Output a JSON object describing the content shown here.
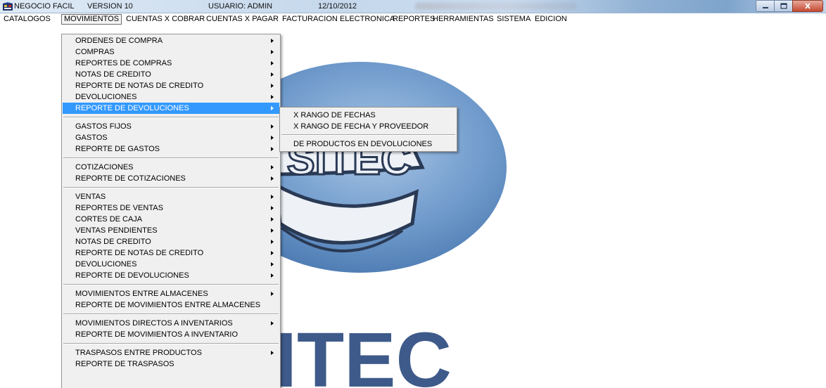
{
  "window": {
    "app_name": "NEGOCIO FACIL",
    "version": "VERSION 10",
    "user": "USUARIO: ADMIN",
    "date": "12/10/2012"
  },
  "icons": [
    "app-icon",
    "minimize-icon",
    "maximize-icon",
    "close-icon",
    "submenu-arrow-icon"
  ],
  "colors": {
    "highlight": "#3399ff",
    "menu_bg": "#f0f0f0",
    "close_button": "#c54a33"
  },
  "menubar": {
    "items": [
      {
        "label": "CATALOGOS"
      },
      {
        "label": "MOVIMIENTOS",
        "active": true
      },
      {
        "label": "CUENTAS X COBRAR"
      },
      {
        "label": "CUENTAS X PAGAR"
      },
      {
        "label": "FACTURACION ELECTRONICA"
      },
      {
        "label": "REPORTES"
      },
      {
        "label": "HERRAMIENTAS"
      },
      {
        "label": "SISTEMA"
      },
      {
        "label": "EDICION"
      }
    ]
  },
  "movimientos_menu": {
    "items": [
      {
        "label": "ORDENES DE COMPRA",
        "submenu": true
      },
      {
        "label": "COMPRAS",
        "submenu": true
      },
      {
        "label": "REPORTES DE COMPRAS",
        "submenu": true
      },
      {
        "label": "NOTAS DE CREDITO",
        "submenu": true
      },
      {
        "label": "REPORTE DE NOTAS DE CREDITO",
        "submenu": true
      },
      {
        "label": "DEVOLUCIONES",
        "submenu": true
      },
      {
        "label": "REPORTE DE DEVOLUCIONES",
        "submenu": true,
        "highlighted": true
      },
      {
        "label": "GASTOS FIJOS",
        "submenu": true
      },
      {
        "label": "GASTOS",
        "submenu": true
      },
      {
        "label": "REPORTE DE GASTOS",
        "submenu": true
      },
      {
        "label": "COTIZACIONES",
        "submenu": true
      },
      {
        "label": "REPORTE DE COTIZACIONES",
        "submenu": true
      },
      {
        "label": "VENTAS",
        "submenu": true
      },
      {
        "label": "REPORTES DE VENTAS",
        "submenu": true
      },
      {
        "label": "CORTES DE CAJA",
        "submenu": true
      },
      {
        "label": "VENTAS PENDIENTES",
        "submenu": true
      },
      {
        "label": "NOTAS DE CREDITO",
        "submenu": true
      },
      {
        "label": "REPORTE DE NOTAS DE CREDITO",
        "submenu": true
      },
      {
        "label": "DEVOLUCIONES",
        "submenu": true
      },
      {
        "label": "REPORTE DE DEVOLUCIONES",
        "submenu": true
      },
      {
        "label": "MOVIMIENTOS ENTRE ALMACENES",
        "submenu": true
      },
      {
        "label": "REPORTE DE MOVIMIENTOS ENTRE ALMACENES",
        "submenu": false
      },
      {
        "label": "MOVIMIENTOS DIRECTOS A INVENTARIOS",
        "submenu": true
      },
      {
        "label": "REPORTE DE MOVIMIENTOS A INVENTARIO",
        "submenu": false
      },
      {
        "label": "TRASPASOS ENTRE PRODUCTOS",
        "submenu": true
      },
      {
        "label": "REPORTE DE TRASPASOS",
        "submenu": false
      }
    ]
  },
  "reporte_devoluciones_submenu": {
    "items": [
      {
        "label": "X RANGO DE FECHAS"
      },
      {
        "label": "X RANGO DE FECHA Y PROVEEDOR"
      },
      {
        "label": "DE PRODUCTOS EN DEVOLUCIONES"
      }
    ]
  },
  "background_logo": {
    "text": "SITEC",
    "emblem_text": "SITEC"
  }
}
